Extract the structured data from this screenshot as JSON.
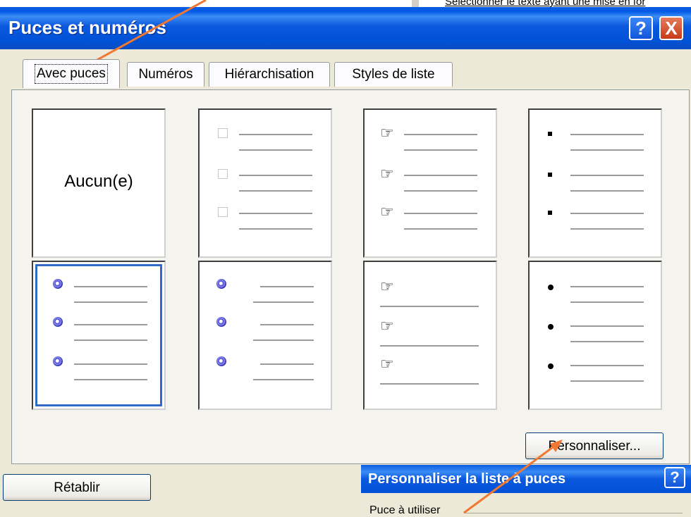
{
  "background": {
    "text": "Sélectionner le texte ayant une mise en for"
  },
  "dialog": {
    "title": "Puces et numéros",
    "help": "?",
    "close": "X"
  },
  "tabs": [
    {
      "label": "Avec puces",
      "active": true
    },
    {
      "label": "Numéros",
      "active": false
    },
    {
      "label": "Hiérarchisation",
      "active": false
    },
    {
      "label": "Styles de liste",
      "active": false
    }
  ],
  "gallery": {
    "none_label": "Aucun(e)",
    "items": [
      {
        "style": "none"
      },
      {
        "style": "empty-square-icon"
      },
      {
        "style": "pointing-hand-icon"
      },
      {
        "style": "small-square-icon"
      },
      {
        "style": "spiral-icon",
        "selected": true
      },
      {
        "style": "spiral-icon"
      },
      {
        "style": "pointing-hand-icon"
      },
      {
        "style": "round-dot-icon"
      }
    ]
  },
  "buttons": {
    "customize": "Personnaliser...",
    "reset": "Rétablir"
  },
  "subdialog": {
    "title": "Personnaliser la liste à puces",
    "help": "?",
    "bullet_label": "Puce à utiliser"
  },
  "colors": {
    "titlebar": "#0052d6",
    "dialog_bg": "#ece9d8",
    "arrow": "#f07830",
    "selection": "#316ac5"
  }
}
